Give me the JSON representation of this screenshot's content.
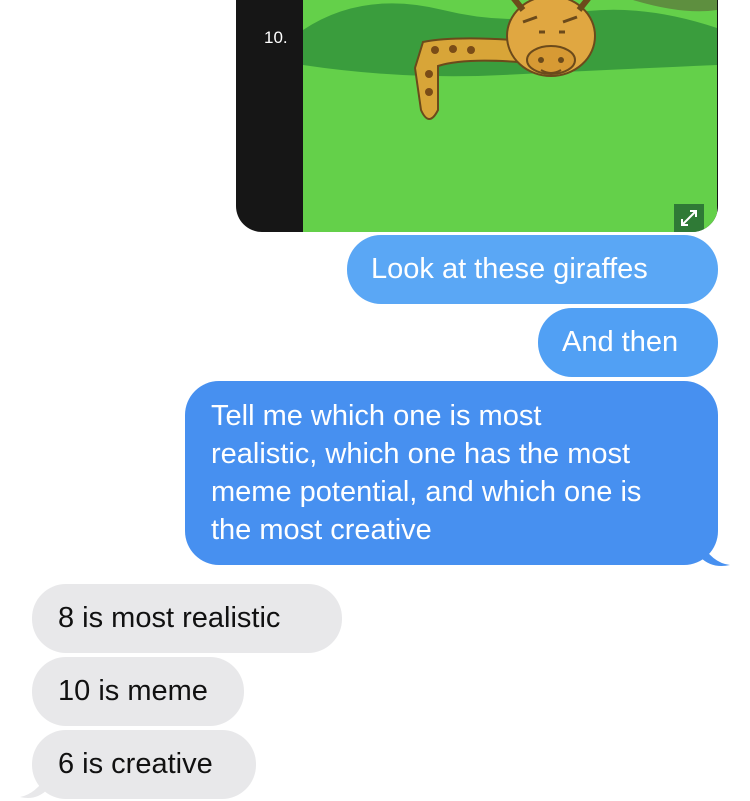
{
  "media": {
    "label": "10.",
    "image_icon": "giraffe-drawing-image",
    "expand_icon": "expand-arrows-icon"
  },
  "messages": {
    "sent": [
      {
        "text": "Look at these giraffes"
      },
      {
        "text": "And then"
      },
      {
        "lines": [
          "Tell me which one is most",
          "realistic, which one has the most",
          "meme potential, and which one is",
          "the most creative"
        ]
      }
    ],
    "received": [
      {
        "text": "8 is most realistic"
      },
      {
        "text": "10 is meme"
      },
      {
        "text": "6 is creative"
      }
    ]
  },
  "colors": {
    "sent_bubble": "#4790f0",
    "received_bubble": "#e8e8ea",
    "media_background": "#161616"
  }
}
